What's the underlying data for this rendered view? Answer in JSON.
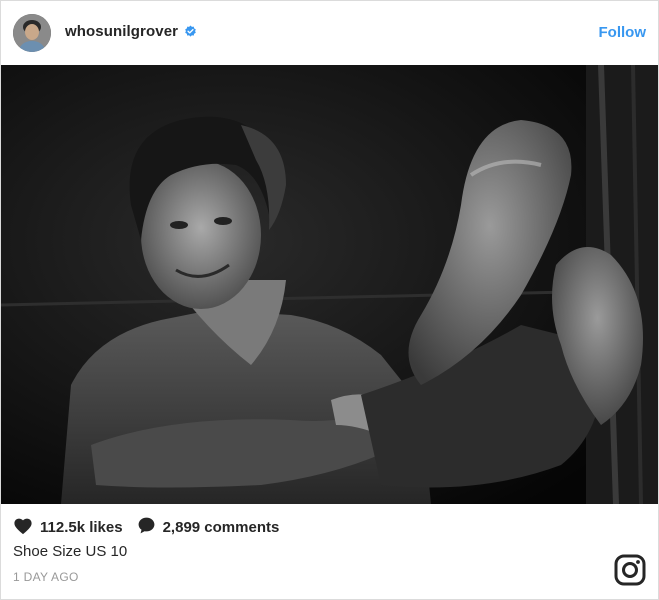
{
  "post": {
    "username": "whosunilgrover",
    "follow_label": "Follow",
    "likes": "112.5k likes",
    "comments": "2,899 comments",
    "caption": "Shoe Size US 10",
    "timestamp": "1 DAY AGO"
  },
  "icons": {
    "verified": "verified-badge-icon",
    "likes": "heart-icon",
    "comments": "comment-bubble-icon",
    "brand": "instagram-logo-icon"
  },
  "colors": {
    "link_blue": "#3897f0",
    "text": "#262626",
    "muted": "#999999",
    "border": "#dbdbdb"
  }
}
